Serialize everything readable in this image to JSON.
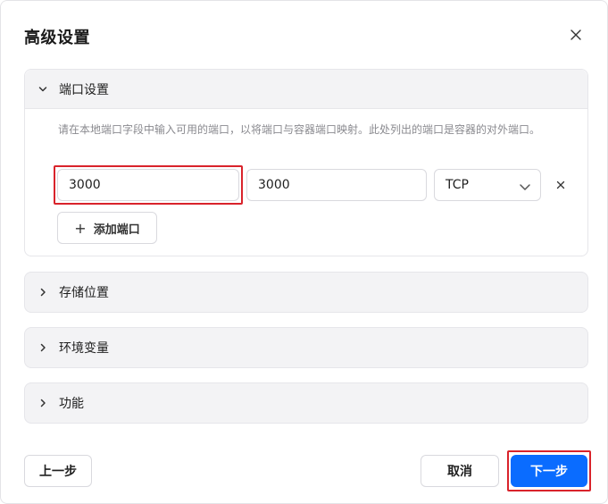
{
  "dialog": {
    "title": "高级设置",
    "close_icon": "close-icon"
  },
  "sections": {
    "ports": {
      "label": "端口设置",
      "expanded": true,
      "description": "请在本地端口字段中输入可用的端口，以将端口与容器端口映射。此处列出的端口是容器的对外端口。",
      "mappings": [
        {
          "local_port": "3000",
          "container_port": "3000",
          "protocol": "TCP"
        }
      ],
      "add_button": "添加端口",
      "add_icon": "+"
    },
    "storage": {
      "label": "存储位置",
      "expanded": false
    },
    "env": {
      "label": "环境变量",
      "expanded": false
    },
    "features": {
      "label": "功能",
      "expanded": false
    }
  },
  "footer": {
    "prev_label": "上一步",
    "cancel_label": "取消",
    "next_label": "下一步"
  },
  "colors": {
    "primary": "#0a6cff",
    "highlight": "#d9232b",
    "section_bg": "#f3f3f5"
  }
}
